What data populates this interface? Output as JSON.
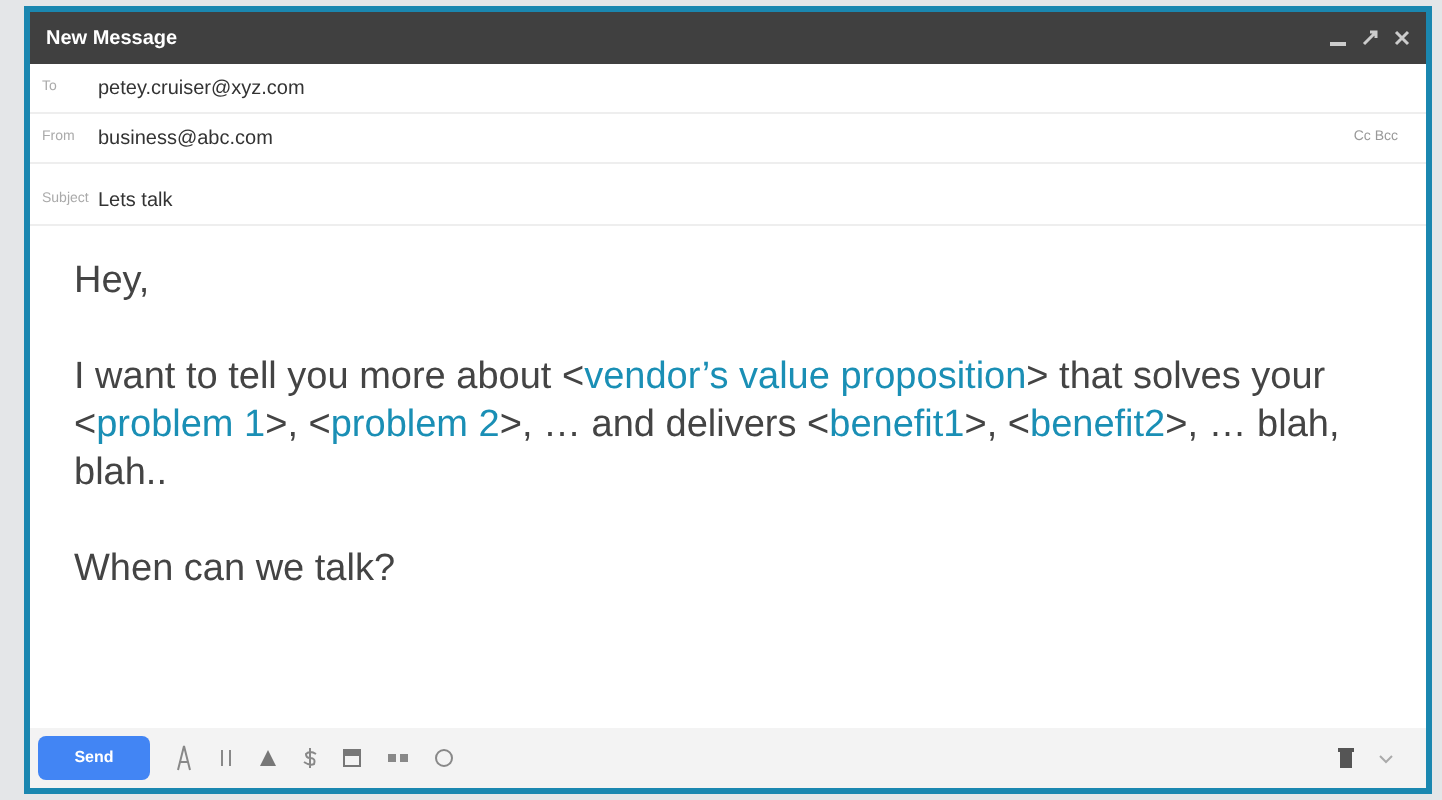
{
  "window": {
    "title": "New Message"
  },
  "fields": [
    {
      "label": "To",
      "value": "petey.cruiser@xyz.com"
    },
    {
      "label": "From",
      "value": "business@abc.com",
      "extra": "Cc Bcc"
    },
    {
      "label": "Subject",
      "value": "Lets talk"
    }
  ],
  "body": [
    [
      {
        "kind": "plain",
        "text": "Hey,"
      }
    ],
    [
      {
        "kind": "plain",
        "text": "I want to tell you more about <"
      },
      {
        "kind": "placeholder",
        "text": "vendor’s value proposition"
      },
      {
        "kind": "plain",
        "text": "> that solves your <"
      },
      {
        "kind": "placeholder",
        "text": "problem 1"
      },
      {
        "kind": "plain",
        "text": ">, <"
      },
      {
        "kind": "placeholder",
        "text": "problem 2"
      },
      {
        "kind": "plain",
        "text": ">, … and delivers <"
      },
      {
        "kind": "placeholder",
        "text": "benefit1"
      },
      {
        "kind": "plain",
        "text": ">, <"
      },
      {
        "kind": "placeholder",
        "text": "benefit2"
      },
      {
        "kind": "plain",
        "text": ">, … blah, blah.."
      }
    ],
    [
      {
        "kind": "plain",
        "text": "When can we talk?"
      }
    ]
  ],
  "toolbar": {
    "send": "Send"
  }
}
